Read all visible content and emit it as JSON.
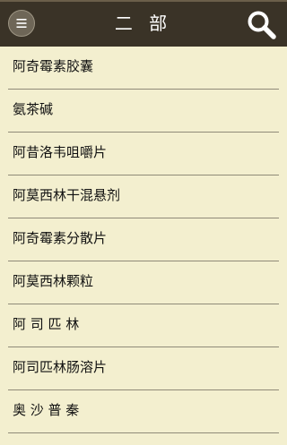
{
  "header": {
    "title": "二 部",
    "menu_icon": "hamburger-menu-icon",
    "search_icon": "search-icon"
  },
  "colors": {
    "header_bg": "#3a3327",
    "page_bg": "#f3efcf",
    "divider": "#8f8a78"
  },
  "drugs": [
    {
      "label": "阿奇霉素胶囊"
    },
    {
      "label": "氨茶碱"
    },
    {
      "label": "阿昔洛韦咀嚼片"
    },
    {
      "label": "阿莫西林干混悬剂"
    },
    {
      "label": "阿奇霉素分散片"
    },
    {
      "label": "阿莫西林颗粒"
    },
    {
      "label": "阿 司 匹 林"
    },
    {
      "label": "阿司匹林肠溶片"
    },
    {
      "label": "奥 沙 普 秦"
    }
  ]
}
